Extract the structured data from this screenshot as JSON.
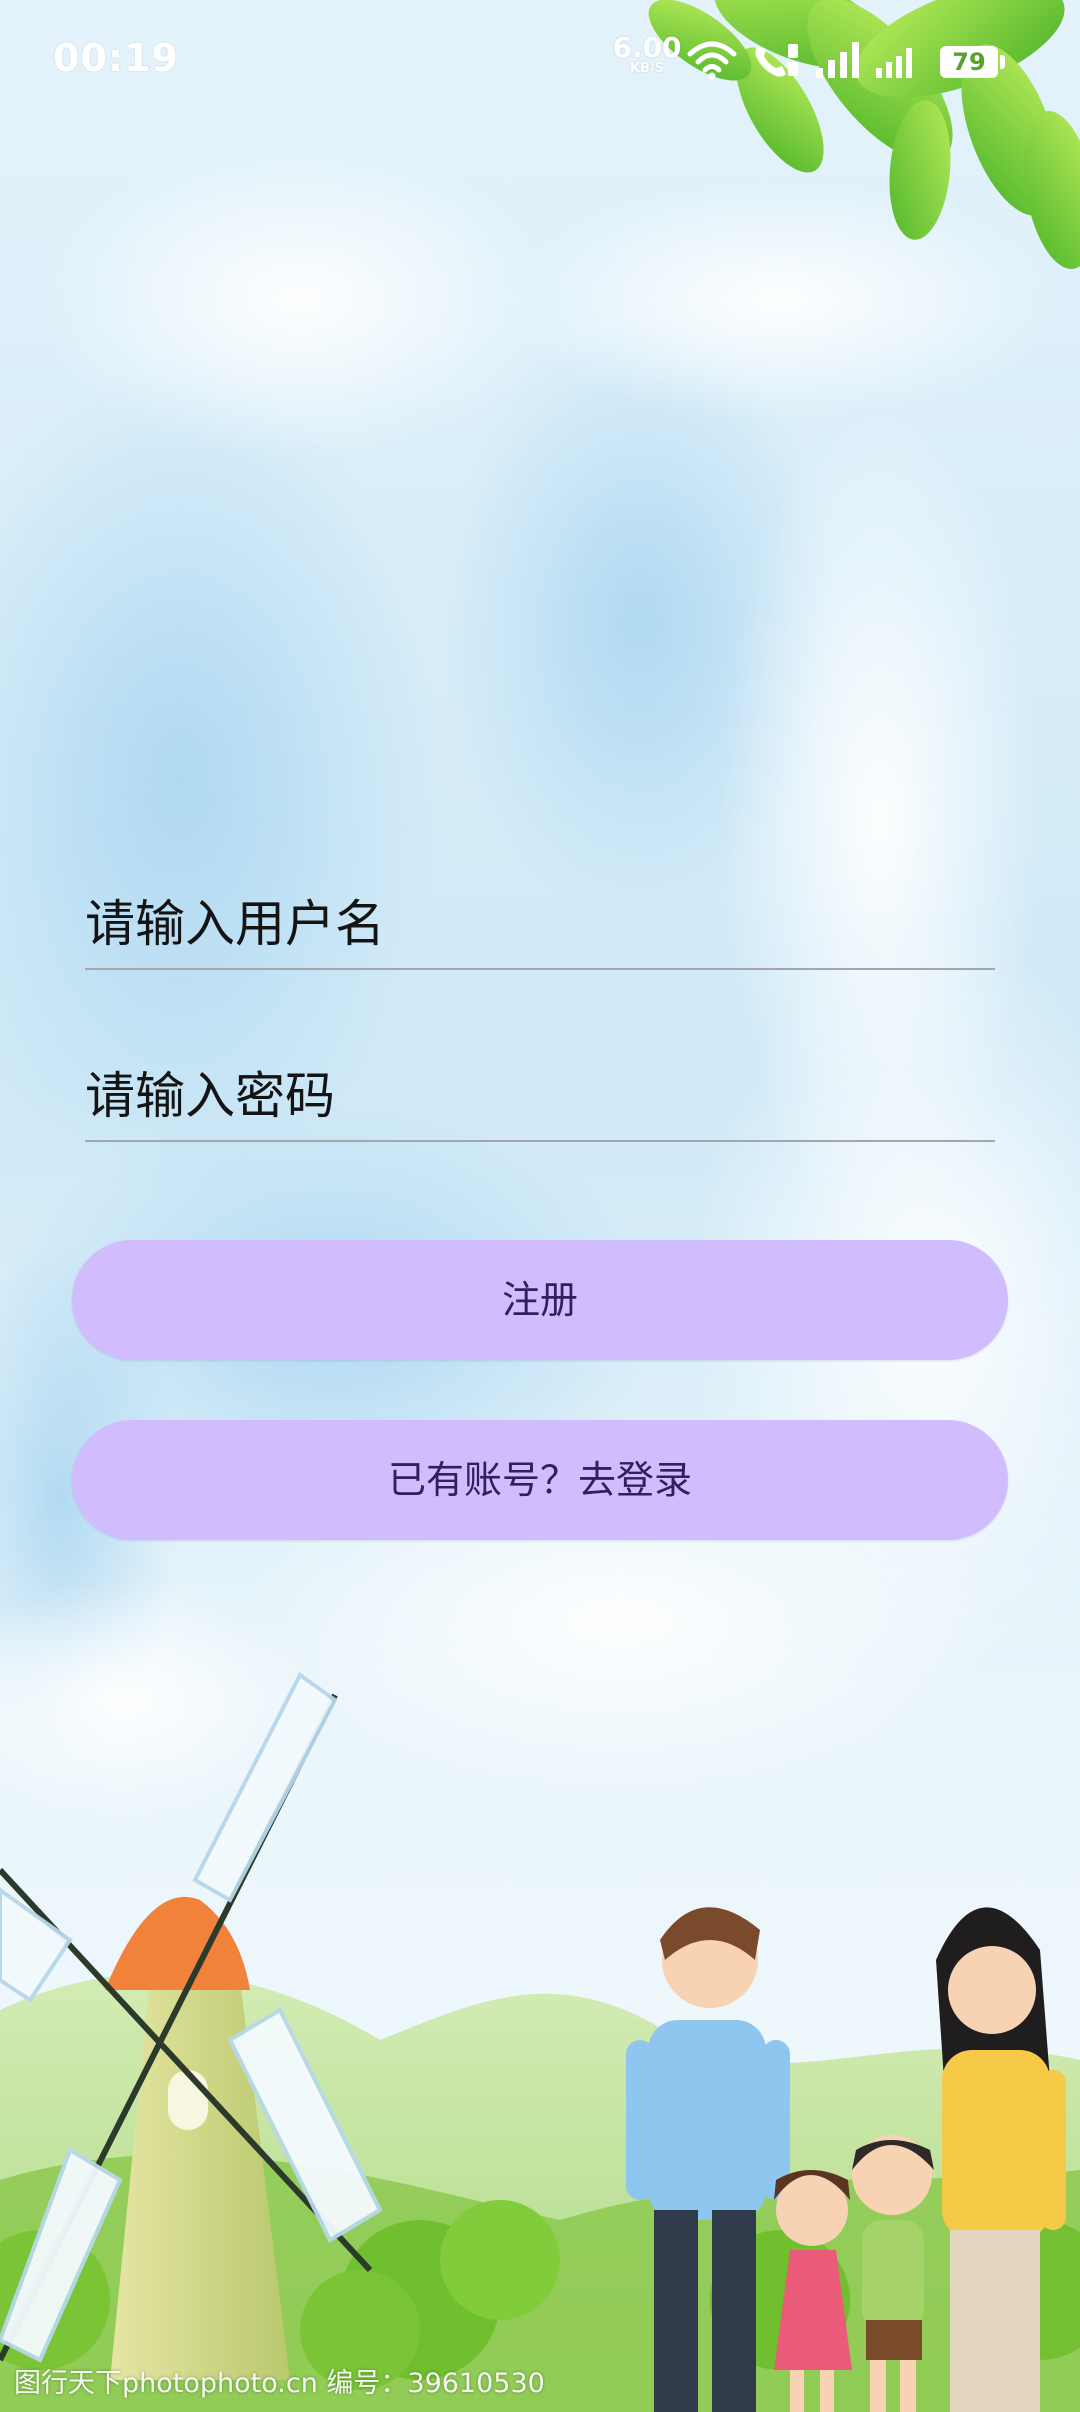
{
  "status_bar": {
    "time": "00:19",
    "net_speed_value": "6.00",
    "net_speed_unit": "KB/S",
    "battery_level": "79",
    "icons": [
      "wifi-icon",
      "call-icon",
      "signal-strength-icon",
      "signal-strength-2-icon"
    ]
  },
  "form": {
    "username_placeholder": "请输入用户名",
    "password_placeholder": "请输入密码",
    "register_label": "注册",
    "login_link_label": "已有账号？去登录"
  },
  "background": {
    "watermark": "图行天下photophoto.cn 编号：39610530",
    "illustration": "windmill-family-illustration"
  },
  "colors": {
    "button_bg": "#d1bdfd",
    "button_text": "#2f1f63",
    "underline": "#a6a4ad"
  }
}
